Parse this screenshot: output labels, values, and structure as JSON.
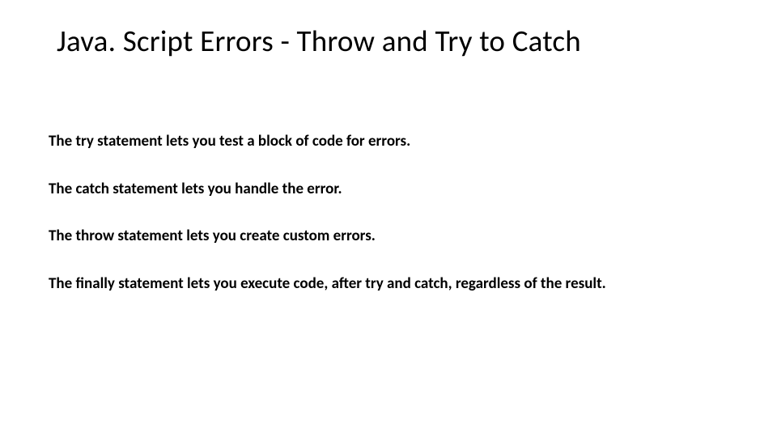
{
  "title": "Java. Script Errors - Throw and Try to Catch",
  "paragraphs": [
    "The try statement lets you test a block of code for errors.",
    "The catch statement lets you handle the error.",
    "The throw statement lets you create custom errors.",
    "The finally statement lets you execute code, after try and catch, regardless of the result."
  ]
}
